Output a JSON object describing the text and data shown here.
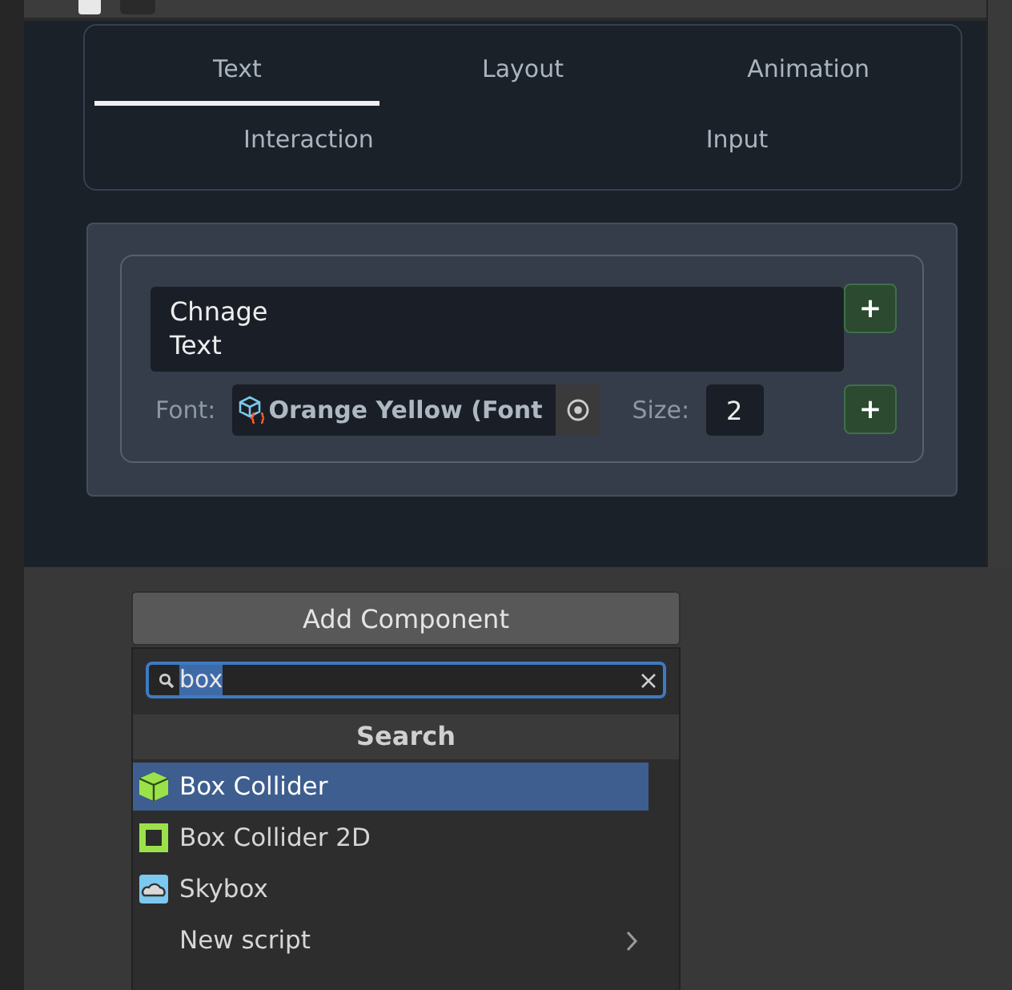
{
  "tab_rows": [
    [
      {
        "label": "Text",
        "selected": true
      },
      {
        "label": "Layout",
        "selected": false
      },
      {
        "label": "Animation",
        "selected": false
      }
    ],
    [
      {
        "label": "Interaction",
        "selected": false
      },
      {
        "label": "Input",
        "selected": false
      }
    ]
  ],
  "text_editor": {
    "value": "Chnage\nText",
    "font_label": "Font:",
    "font_value": "Orange Yellow (Font",
    "size_label": "Size:",
    "size_value": "2",
    "add_buttons": [
      "+",
      "+"
    ]
  },
  "add_component": {
    "button": "Add Component",
    "search": {
      "value": "box"
    },
    "header": "Search",
    "items": [
      {
        "label": "Box Collider",
        "kind": "cube",
        "selected": true
      },
      {
        "label": "Box Collider 2D",
        "kind": "square",
        "selected": false
      },
      {
        "label": "Skybox",
        "kind": "cloud",
        "selected": false
      },
      {
        "label": "New script",
        "kind": "submenu",
        "selected": false
      }
    ]
  }
}
